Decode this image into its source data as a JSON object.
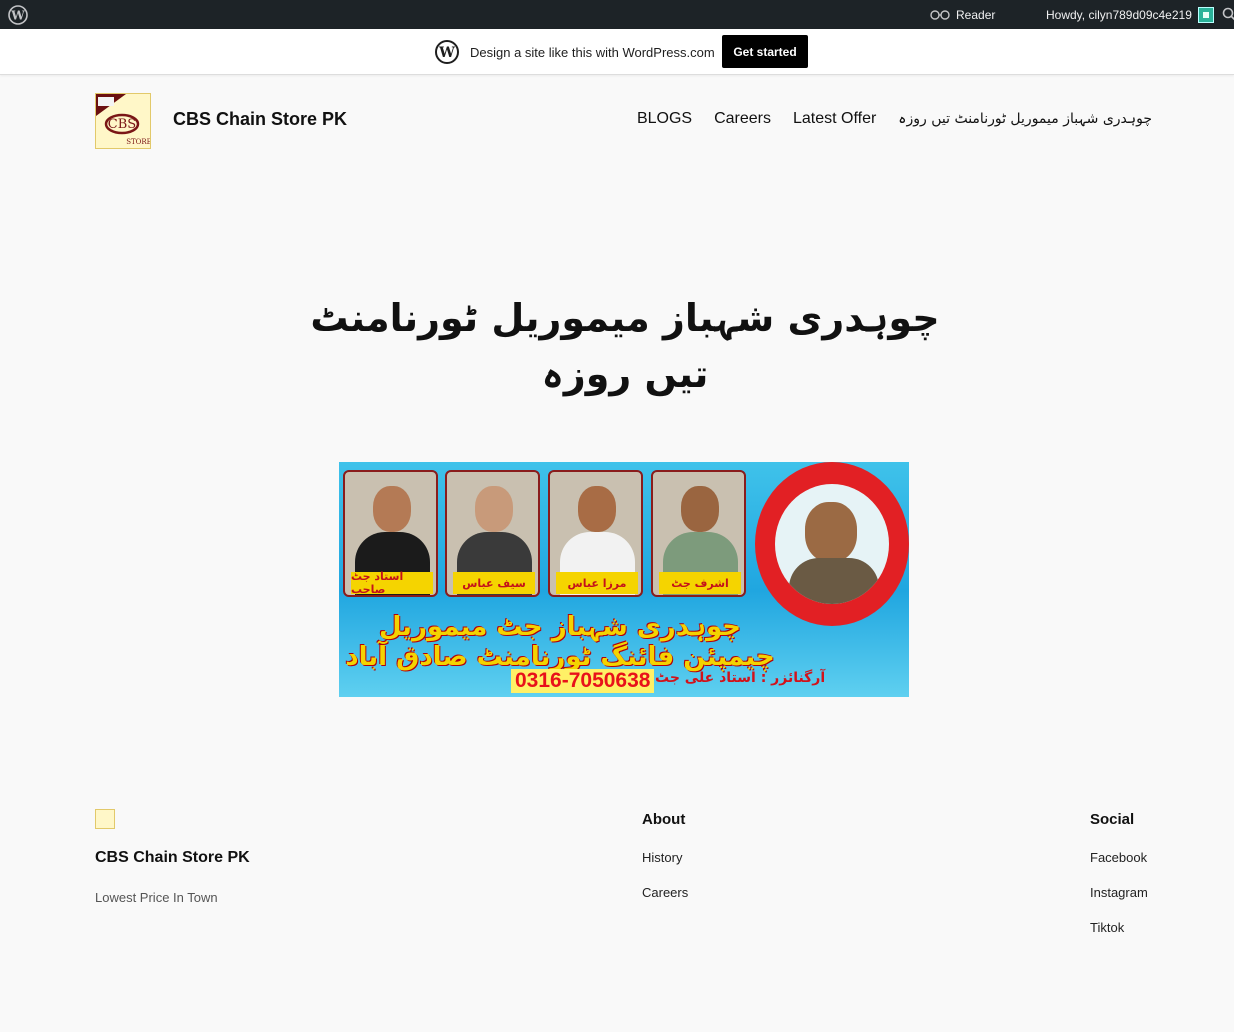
{
  "admin_bar": {
    "reader_label": "Reader",
    "howdy": "Howdy, cilyn789d09c4e219"
  },
  "promo": {
    "text": "Design a site like this with WordPress.com",
    "cta": "Get started"
  },
  "header": {
    "site_title": "CBS Chain Store PK",
    "nav": [
      "BLOGS",
      "Careers",
      "Latest Offer",
      "چوہدری شہباز میموریل ٹورنامنٹ تیں روزہ"
    ]
  },
  "post": {
    "title_line1": "چوہدری شہباز میموریل ٹورنامنٹ",
    "title_line2": "تیں روزہ",
    "banner": {
      "captions": [
        "استاد جٹ صاحب",
        "سیف عباس",
        "مرزا عباس",
        "اشرف جٹ"
      ],
      "headline": "چوہدری شہباز جٹ میموریل چیمپئن فائنگ ٹورنامنٹ صادق آباد",
      "phone": "0316-7050638",
      "organizer": "آرگنائزر : استاد علی جٹ"
    }
  },
  "footer": {
    "site_title": "CBS Chain Store PK",
    "tagline": "Lowest Price In Town",
    "about": {
      "heading": "About",
      "links": [
        "History",
        "Careers"
      ]
    },
    "social": {
      "heading": "Social",
      "links": [
        "Facebook",
        "Instagram",
        "Tiktok"
      ]
    }
  },
  "colors": {
    "admin_bar_bg": "#1d2327",
    "page_bg": "#f9f9f9",
    "cta_bg": "#000000",
    "banner_blue": "#20a6e0",
    "banner_red": "#e22024",
    "banner_yellow": "#f4d300"
  }
}
